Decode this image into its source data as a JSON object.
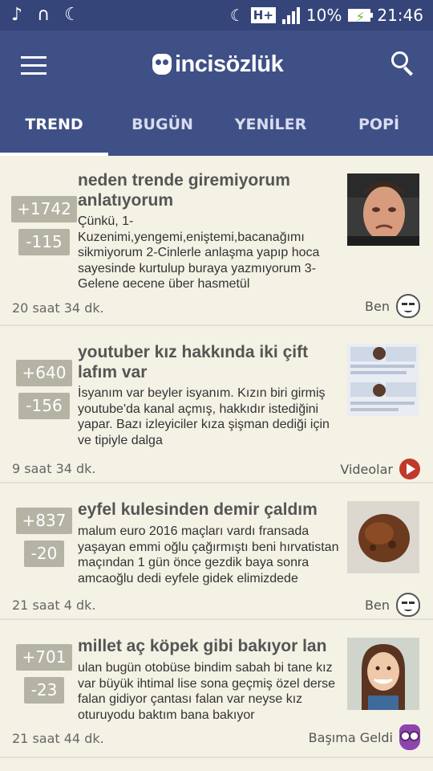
{
  "status": {
    "percent": "10%",
    "time": "21:46",
    "network": "H+"
  },
  "app": {
    "title": "incisözlük"
  },
  "tabs": [
    "TREND",
    "BUGÜN",
    "YENİLER",
    "POPİ"
  ],
  "entries": [
    {
      "up": "+1742",
      "down": "-115",
      "title": "neden trende giremiyorum anlatıyorum",
      "text": "Çünkü, 1-Kuzenimi,yengemi,eniştemi,bacanağımı sikmiyorum 2-Cinlerle anlaşma yapıp hoca sayesinde kurtulup buraya yazmıyorum 3-Gelene geçene über haşmetül",
      "time": "20 saat 34 dk.",
      "category": "Ben",
      "category_icon": "mask-icon",
      "thumb": "crying-man-photo"
    },
    {
      "up": "+640",
      "down": "-156",
      "title": "youtuber kız hakkında iki çift lafım var",
      "text": "İsyanım var beyler isyanım. Kızın biri girmiş youtube'da kanal açmış, hakkıdır istediğini yapar. Bazı izleyiciler kıza şişman dediği için ve tipiyle dalga",
      "time": "9 saat 34 dk.",
      "category": "Videolar",
      "category_icon": "play-icon",
      "thumb": "youtube-collage-photo"
    },
    {
      "up": "+837",
      "down": "-20",
      "title": "eyfel kulesinden demir çaldım",
      "text": "malum euro 2016 maçları vardı fransada yaşayan emmi oğlu çağırmıştı beni hırvatistan maçından 1 gün önce gezdik baya sonra amcaoğlu dedi eyfele gidek elimizdede",
      "time": "21 saat 4 dk.",
      "category": "Ben",
      "category_icon": "mask-icon",
      "thumb": "rusty-iron-photo"
    },
    {
      "up": "+701",
      "down": "-23",
      "title": "millet aç köpek gibi bakıyor lan",
      "text": "ulan bugün otobüse bindim sabah bi tane kız var büyük ihtimal lise sona geçmiş özel derse falan gidiyor çantası falan var neyse kız oturuyodu baktım bana bakıyor",
      "time": "21 saat 44 dk.",
      "category": "Başıma Geldi",
      "category_icon": "owl-icon",
      "thumb": "smiling-girl-photo"
    }
  ]
}
